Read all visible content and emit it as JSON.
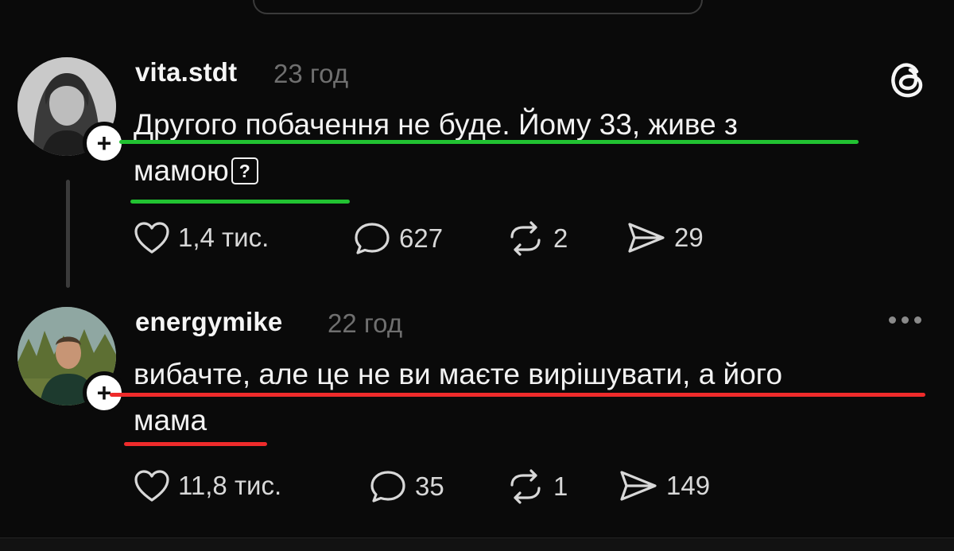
{
  "posts": [
    {
      "username": "vita.stdt",
      "time": "23 год",
      "text_line1": "Другого побачення не буде. Йому 33, живе з",
      "text_line2": "мамою",
      "inline_glyph": "?",
      "underline_color": "#22c232",
      "actions": {
        "likes": "1,4 тис.",
        "comments": "627",
        "reposts": "2",
        "shares": "29"
      },
      "follow_symbol": "+",
      "corner_icon": "threads-logo-icon"
    },
    {
      "username": "energymike",
      "time": "22 год",
      "text_line1": "вибачте, але це не ви маєте вирішувати, а його",
      "text_line2": "мама",
      "underline_color": "#ef2b2b",
      "actions": {
        "likes": "11,8 тис.",
        "comments": "35",
        "reposts": "1",
        "shares": "149"
      },
      "follow_symbol": "+",
      "corner_icon": "more-options-icon"
    }
  ]
}
